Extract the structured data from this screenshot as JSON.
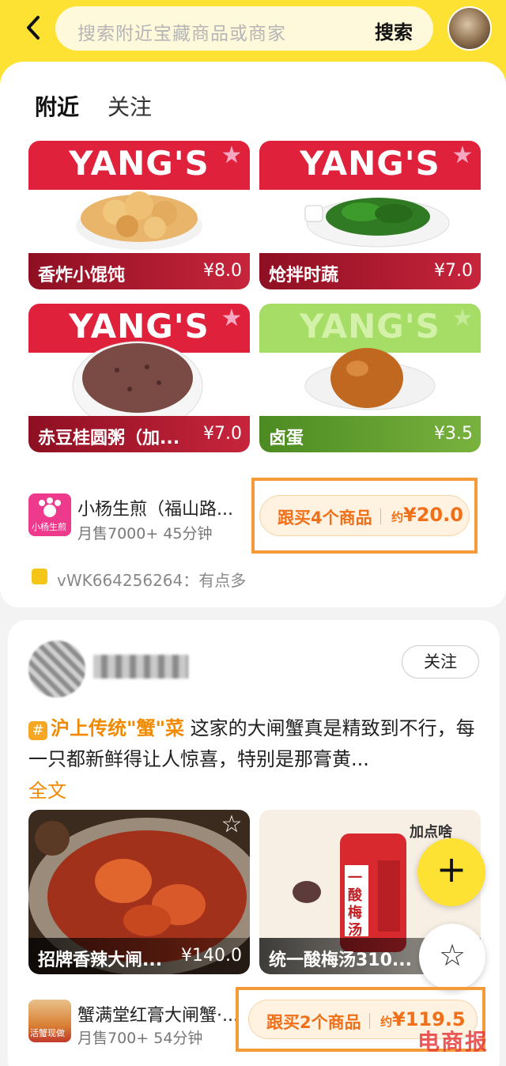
{
  "header": {
    "back_icon": "chevron-left-icon",
    "search_placeholder": "搜索附近宝藏商品或商家",
    "search_button": "搜索"
  },
  "tabs": [
    {
      "label": "附近",
      "active": true
    },
    {
      "label": "关注",
      "active": false
    }
  ],
  "post1": {
    "brand": "YANG'S",
    "products": [
      {
        "name": "香炸小馄饨",
        "price": "¥8.0"
      },
      {
        "name": "炝拌时蔬",
        "price": "¥7.0"
      },
      {
        "name": "赤豆桂圆粥（加...",
        "price": "¥7.0"
      },
      {
        "name": "卤蛋",
        "price": "¥3.5"
      }
    ],
    "shop": {
      "logo_text": "小杨生煎",
      "name": "小杨生煎（福山路...",
      "meta": "月售7000+ 45分钟"
    },
    "buy": {
      "label": "跟买4个商品",
      "price_prefix": "约",
      "price": "¥20.0"
    },
    "comment": "vWK664256264：有点多"
  },
  "post2": {
    "follow_label": "关注",
    "tag": "沪上传统\"蟹\"菜",
    "text": "这家的大闸蟹真是精致到不行，每一只都新鲜得让人惊喜，特别是那膏黄...",
    "full_text_label": "全文",
    "products": [
      {
        "name": "招牌香辣大闸...",
        "price": "¥140.0"
      },
      {
        "name": "统一酸梅汤310...",
        "price": ""
      }
    ],
    "drink_brand": "加点啥",
    "drink_can_text": "一酸梅汤",
    "shop": {
      "name": "蟹满堂红膏大闸蟹·...",
      "meta": "月售700+ 54分钟",
      "logo_text": "活蟹现做"
    },
    "buy": {
      "label": "跟买2个商品",
      "price_prefix": "约",
      "price": "¥119.5"
    }
  },
  "fab": {
    "add_icon": "plus-icon",
    "fav_icon": "star-icon"
  },
  "watermark": "电商报",
  "colors": {
    "accent_yellow": "#fde234",
    "orange": "#f0701a",
    "brand_red": "#e0213b"
  }
}
